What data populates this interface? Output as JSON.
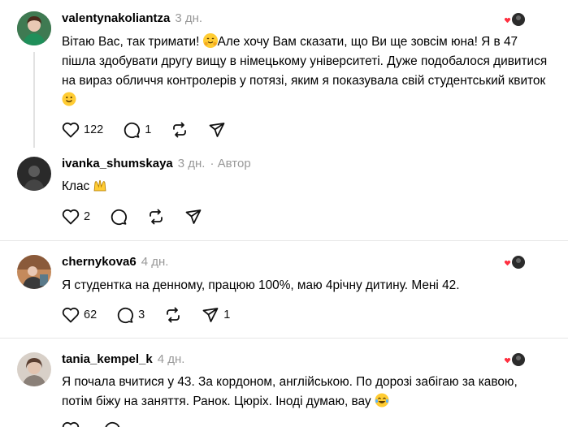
{
  "posts": [
    {
      "username": "valentynakoliantza",
      "time": "3 дн.",
      "text_parts": [
        "Вітаю Вас, так тримати! ",
        "Але хочу Вам сказати, що Ви ще зовсім юна! Я в 47 пішла здобувати другу вищу в німецькому університеті. Дуже подобалося дивитися на вираз обличчя контролерів у потязі, яким я показувала свій студентський квиток "
      ],
      "likes": "122",
      "replies": "1",
      "reposts": "",
      "shares": ""
    },
    {
      "username": "ivanka_shumskaya",
      "time": "3 дн.",
      "author_tag": "· Автор",
      "text": "Клас ",
      "likes": "2",
      "replies": "",
      "reposts": "",
      "shares": ""
    },
    {
      "username": "chernykova6",
      "time": "4 дн.",
      "text": "Я студентка на денному, працюю 100%, маю 4річну дитину. Мені 42.",
      "likes": "62",
      "replies": "3",
      "reposts": "",
      "shares": "1"
    },
    {
      "username": "tania_kempel_k",
      "time": "4 дн.",
      "text": "Я почала вчитися у 43. За кордоном, англійською. По дорозі забігаю за кавою, потім біжу на заняття. Ранок. Цюріх. Іноді думаю, вау ",
      "likes": "",
      "replies": "",
      "reposts": "",
      "shares": ""
    }
  ],
  "icons": {
    "like": "heart-icon",
    "reply": "comment-icon",
    "repost": "repost-icon",
    "share": "share-icon",
    "liked_by_author": "author-like-badge-icon"
  },
  "colors": {
    "text": "#000000",
    "meta": "#999999",
    "accent_red": "#ff3040",
    "divider": "#e6e6e6"
  }
}
